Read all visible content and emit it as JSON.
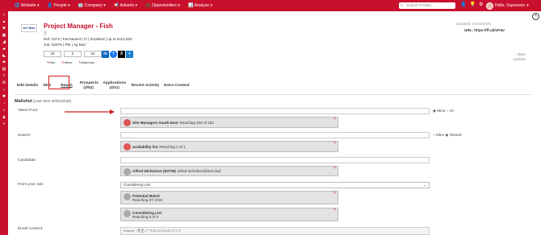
{
  "topbar": {
    "menu": [
      "Website",
      "People",
      "Company",
      "Adverts",
      "Opportunities",
      "Analyse"
    ],
    "search_placeholder": "Search Firefish...",
    "user_greeting": "Hello, Superuser"
  },
  "job": {
    "logo_text": "AG Barr",
    "title": "Project Manager - Fish",
    "ref_line": "Ref: 2473 | Permanent | IT | Scotland | up to £110,000",
    "job_line": "Job: 62679 | PM | Ag Barr",
    "counts": [
      "29",
      "0",
      "52"
    ],
    "sub_labels": [
      "Hits",
      "Items",
      "Matchals"
    ],
    "updated": "Updated: 02/02/2026",
    "url": "URL: https://ff.uk/vP.6v",
    "more_actions": "More Actions"
  },
  "social": {
    "linkedin": "in",
    "facebook": "f",
    "twitter": "X",
    "add": "+"
  },
  "tabs": [
    "Edit Details",
    "SEO",
    "Reach",
    "Prospects (3/52)",
    "Applications (4/11)",
    "Recent Activity",
    "Extra Content"
  ],
  "active_tab": "Reach",
  "mailshot": {
    "title": "Mailshot",
    "note": "(Last Sent 30/01/2025)"
  },
  "form": {
    "talent_pool_label": "Talent Pool:",
    "talent_pool_chip_name": "Site Managers South East",
    "talent_pool_chip_info": "Reaching 105 of 152",
    "talent_radio": [
      "Mine",
      "All"
    ],
    "search_label": "Search:",
    "search_chip_name": "availability list",
    "search_chip_info": "Reaching 1 of 1",
    "search_radio": [
      "Mine",
      "Shared"
    ],
    "candidate_label": "Candidate:",
    "candidate_chip_name": "Alfred Nicholson (50706)",
    "candidate_chip_info": "alfred.nicholson@test.dud",
    "from_job_label": "From your Job:",
    "from_job_select": "Considering List",
    "job_chip1_name": "Potential Match",
    "job_chip1_info": "Reaching 37 of 50",
    "job_chip2_name": "Considering List",
    "job_chip2_info": "Reaching 0 of 0",
    "email_content_label": "Email Content:",
    "editor_toolbar": "Source  ⛶  ⎘  ⎗  ↶  ↷  B  I  U  S  A  Ω  ≡  ≡  ≡  ≡"
  },
  "colors": {
    "brand": "#c8102e",
    "annotation": "#d01a1a"
  }
}
